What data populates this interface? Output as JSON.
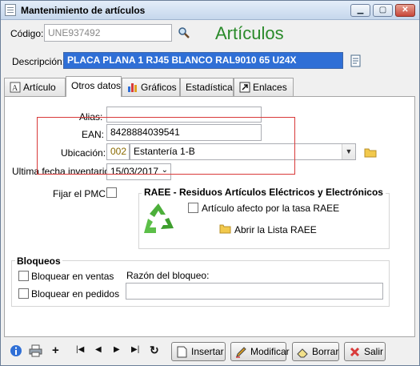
{
  "window": {
    "title": "Mantenimiento de artículos",
    "controls": {
      "minimize": "▁",
      "maximize": "▢",
      "close": "✕"
    }
  },
  "header": {
    "codigo_label": "Código:",
    "codigo_value": "UNE937492",
    "heading": "Artículos",
    "descripcion_label": "Descripción:",
    "descripcion_value": "PLACA PLANA 1 RJ45 BLANCO RAL9010 65 U24X"
  },
  "tabs": [
    {
      "label": "Artículo",
      "icon": "text-icon"
    },
    {
      "label": "Otros datos",
      "icon": "",
      "active": true
    },
    {
      "label": "Gráficos",
      "icon": "bar-chart-icon"
    },
    {
      "label": "Estadística",
      "icon": ""
    },
    {
      "label": "Enlaces",
      "icon": "link-icon"
    }
  ],
  "form": {
    "alias_label": "Alias:",
    "alias_value": "",
    "ean_label": "EAN:",
    "ean_value": "8428884039541",
    "ubicacion_label": "Ubicación:",
    "ubicacion_code": "002",
    "ubicacion_value": "Estantería 1-B",
    "fecha_label": "Ultima fecha inventario:",
    "fecha_value": "15/03/2017",
    "fijar_label": "Fijar el PMC:"
  },
  "raee": {
    "title": "RAEE - Residuos Artículos Eléctricos y Electrónicos",
    "checkbox_label": "Artículo afecto por la tasa RAEE",
    "link_label": "Abrir la Lista RAEE"
  },
  "bloqueos": {
    "title": "Bloqueos",
    "ventas_label": "Bloquear en ventas",
    "pedidos_label": "Bloquear en pedidos",
    "razon_label": "Razón del bloqueo:",
    "razon_value": ""
  },
  "toolbar": {
    "nav": [
      "|◀",
      "◀",
      "▶",
      "▶|",
      "↻"
    ],
    "add": "+",
    "insertar": "Insertar",
    "modificar": "Modificar",
    "borrar": "Borrar",
    "salir": "Salir"
  },
  "colors": {
    "heading": "#2a8a2a",
    "selection": "#2f6fd6",
    "highlight_box": "#d93a3a",
    "code_text": "#8a6a00"
  }
}
